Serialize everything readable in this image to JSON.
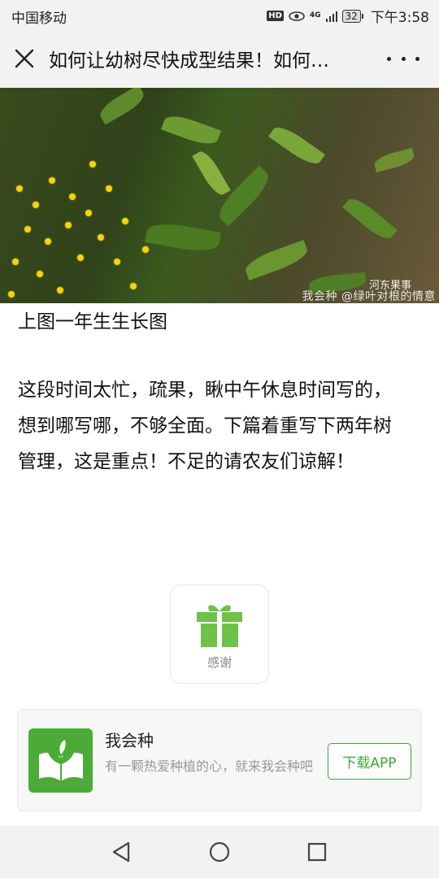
{
  "status_bar": {
    "carrier": "中国移动",
    "hd": "HD",
    "network": "4G",
    "battery": "32",
    "time": "下午3:58"
  },
  "nav": {
    "title": "如何让幼树尽快成型结果！如何…",
    "close_icon": "close-icon",
    "more_icon": "more-icon"
  },
  "image": {
    "watermark_logo": "河东果事",
    "watermark_text": "我会种 @绿叶对根的情意"
  },
  "article": {
    "caption": "上图一年生生长图",
    "paragraph_lines": [
      "这段时间太忙，疏果，瞅中午休息时间写的，",
      "想到哪写哪，不够全面。下篇着重写下两年树",
      "管理，这是重点！不足的请农友们谅解！"
    ]
  },
  "reward": {
    "label": "感谢",
    "icon": "gift-icon",
    "color": "#6fc14a"
  },
  "app_card": {
    "name": "我会种",
    "description": "有一颗热爱种植的心，就来我会种吧",
    "download_label": "下载APP",
    "brand_color": "#4caa38"
  },
  "system_nav": {
    "back_icon": "back-triangle-icon",
    "home_icon": "home-circle-icon",
    "recents_icon": "recents-square-icon"
  }
}
